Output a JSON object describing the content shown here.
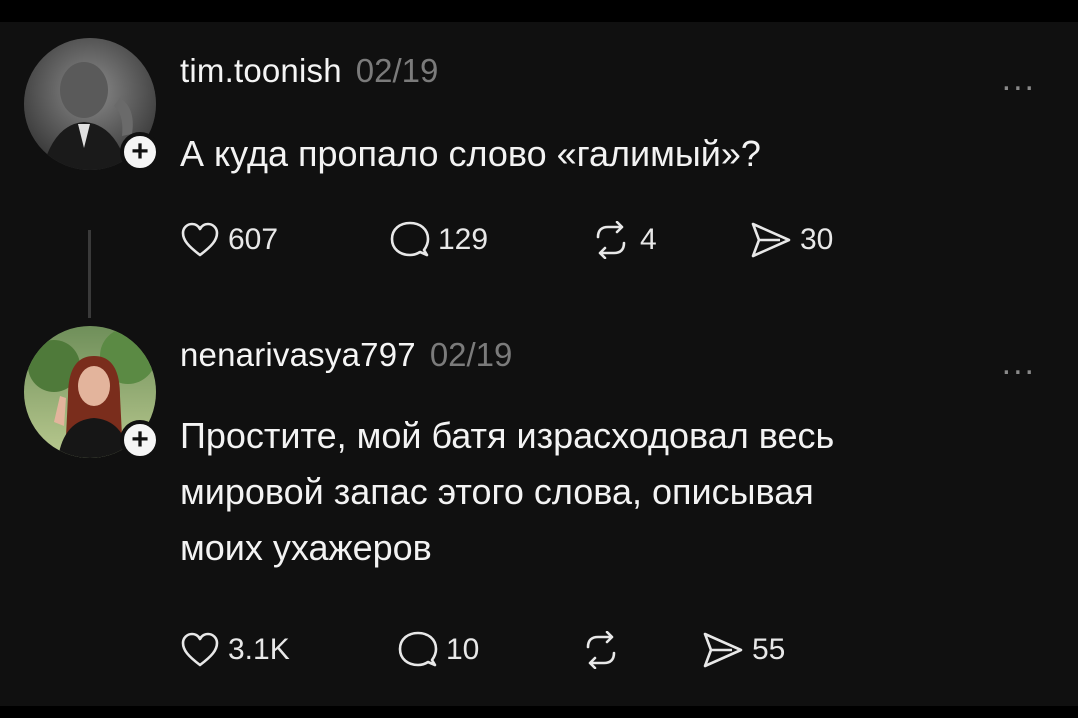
{
  "posts": [
    {
      "username": "tim.toonish",
      "timestamp": "02/19",
      "text": "А куда пропало слово «галимый»?",
      "more": "...",
      "follow": "+",
      "likes": "607",
      "replies": "129",
      "reposts": "4",
      "shares": "30"
    },
    {
      "username": "nenarivasya797",
      "timestamp": "02/19",
      "text": "Простите, мой батя израсходовал весь\nмировой запас этого слова, описывая\nмоих ухажеров",
      "more": "...",
      "follow": "+",
      "likes": "3.1K",
      "replies": "10",
      "reposts": "",
      "shares": "55"
    }
  ],
  "icons": {
    "like": "heart-icon",
    "reply": "comment-icon",
    "repost": "repost-icon",
    "share": "send-icon"
  },
  "colors": {
    "background": "#101010",
    "text": "#f3f3f3",
    "muted": "#7b7b7b"
  }
}
